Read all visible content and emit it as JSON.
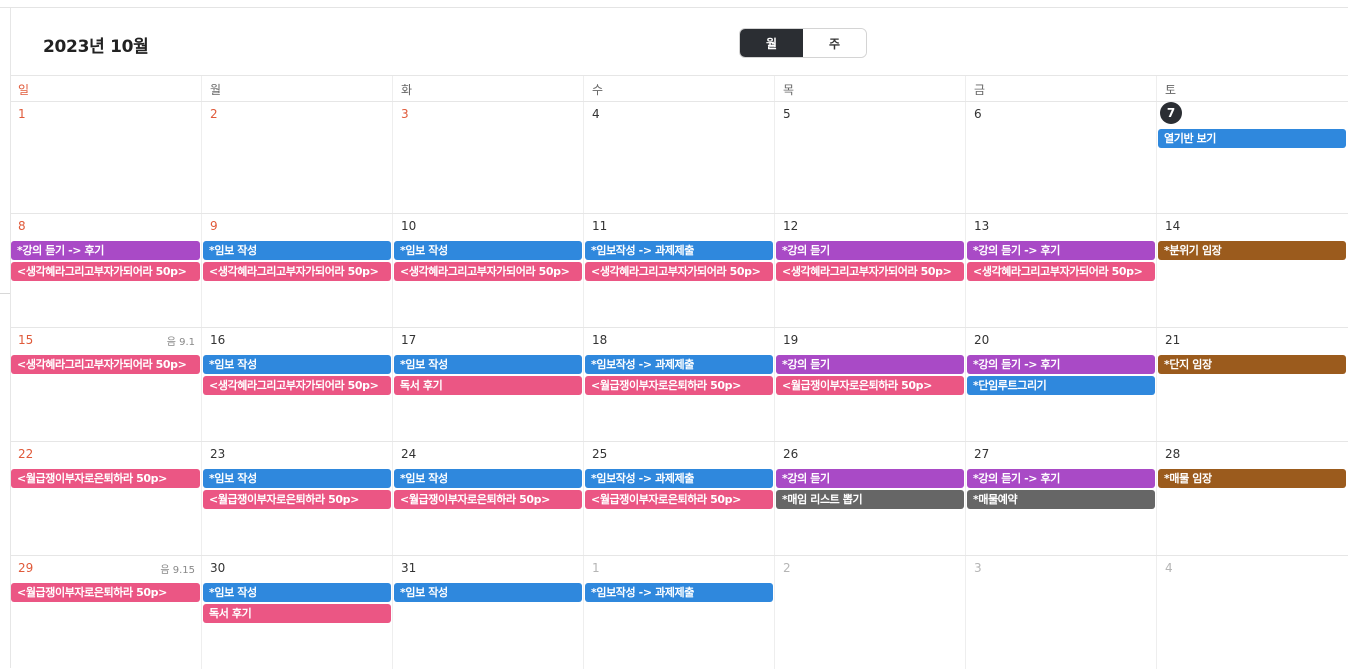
{
  "header": {
    "title": "2023년 10월"
  },
  "view_toggle": {
    "month": "월",
    "week": "주",
    "active": "month"
  },
  "colors": {
    "blue": "#2f88dd",
    "purple": "#a94ac6",
    "pink": "#eb5684",
    "brown": "#9b5b1d",
    "gray": "#666666",
    "sunday_red": "#e05a3a",
    "today_badge": "#2b2e33"
  },
  "dow": [
    "일",
    "월",
    "화",
    "수",
    "목",
    "금",
    "토"
  ],
  "weeks": [
    [
      {
        "day": "1",
        "red": true,
        "events": []
      },
      {
        "day": "2",
        "red": true,
        "events": []
      },
      {
        "day": "3",
        "red": true,
        "events": []
      },
      {
        "day": "4",
        "events": []
      },
      {
        "day": "5",
        "events": []
      },
      {
        "day": "6",
        "events": []
      },
      {
        "day": "7",
        "today": true,
        "events": [
          {
            "label": "열기반 보기",
            "color": "blue"
          }
        ]
      }
    ],
    [
      {
        "day": "8",
        "red": true,
        "events": [
          {
            "label": "*강의 듣기 -> 후기",
            "color": "purple"
          },
          {
            "label": "<생각혜라그리고부자가되어라 50p>",
            "color": "pink"
          }
        ]
      },
      {
        "day": "9",
        "red": true,
        "events": [
          {
            "label": "*임보 작성",
            "color": "blue"
          },
          {
            "label": "<생각혜라그리고부자가되어라 50p>",
            "color": "pink"
          }
        ]
      },
      {
        "day": "10",
        "events": [
          {
            "label": "*임보 작성",
            "color": "blue"
          },
          {
            "label": "<생각혜라그리고부자가되어라 50p>",
            "color": "pink"
          }
        ]
      },
      {
        "day": "11",
        "events": [
          {
            "label": "*임보작성 -> 과제제출",
            "color": "blue"
          },
          {
            "label": "<생각혜라그리고부자가되어라 50p>",
            "color": "pink"
          }
        ]
      },
      {
        "day": "12",
        "events": [
          {
            "label": "*강의 듣기",
            "color": "purple"
          },
          {
            "label": "<생각혜라그리고부자가되어라 50p>",
            "color": "pink"
          }
        ]
      },
      {
        "day": "13",
        "events": [
          {
            "label": "*강의 듣기 -> 후기",
            "color": "purple"
          },
          {
            "label": "<생각혜라그리고부자가되어라 50p>",
            "color": "pink"
          }
        ]
      },
      {
        "day": "14",
        "events": [
          {
            "label": "*분위기 임장",
            "color": "brown"
          }
        ]
      }
    ],
    [
      {
        "day": "15",
        "red": true,
        "lunar": "음 9.1",
        "events": [
          {
            "label": "<생각혜라그리고부자가되어라 50p>",
            "color": "pink"
          }
        ]
      },
      {
        "day": "16",
        "events": [
          {
            "label": "*임보 작성",
            "color": "blue"
          },
          {
            "label": "<생각혜라그리고부자가되어라 50p>",
            "color": "pink"
          }
        ]
      },
      {
        "day": "17",
        "events": [
          {
            "label": "*임보 작성",
            "color": "blue"
          },
          {
            "label": "독서 후기",
            "color": "pink"
          }
        ]
      },
      {
        "day": "18",
        "events": [
          {
            "label": "*임보작성 -> 과제제출",
            "color": "blue"
          },
          {
            "label": "<월급쟁이부자로은퇴하라 50p>",
            "color": "pink"
          }
        ]
      },
      {
        "day": "19",
        "events": [
          {
            "label": "*강의 듣기",
            "color": "purple"
          },
          {
            "label": "<월급쟁이부자로은퇴하라 50p>",
            "color": "pink"
          }
        ]
      },
      {
        "day": "20",
        "events": [
          {
            "label": "*강의 듣기 -> 후기",
            "color": "purple"
          },
          {
            "label": "*단임루트그리기",
            "color": "blue"
          }
        ]
      },
      {
        "day": "21",
        "events": [
          {
            "label": "*단지 임장",
            "color": "brown"
          }
        ]
      }
    ],
    [
      {
        "day": "22",
        "red": true,
        "events": [
          {
            "label": "<월급쟁이부자로은퇴하라 50p>",
            "color": "pink"
          }
        ]
      },
      {
        "day": "23",
        "events": [
          {
            "label": "*임보 작성",
            "color": "blue"
          },
          {
            "label": "<월급쟁이부자로은퇴하라 50p>",
            "color": "pink"
          }
        ]
      },
      {
        "day": "24",
        "events": [
          {
            "label": "*임보 작성",
            "color": "blue"
          },
          {
            "label": "<월급쟁이부자로은퇴하라 50p>",
            "color": "pink"
          }
        ]
      },
      {
        "day": "25",
        "events": [
          {
            "label": "*임보작성 -> 과제제출",
            "color": "blue"
          },
          {
            "label": "<월급쟁이부자로은퇴하라 50p>",
            "color": "pink"
          }
        ]
      },
      {
        "day": "26",
        "events": [
          {
            "label": "*강의 듣기",
            "color": "purple"
          },
          {
            "label": "*매임 리스트 뽑기",
            "color": "gray"
          }
        ]
      },
      {
        "day": "27",
        "events": [
          {
            "label": "*강의 듣기 -> 후기",
            "color": "purple"
          },
          {
            "label": "*매물예약",
            "color": "gray"
          }
        ]
      },
      {
        "day": "28",
        "events": [
          {
            "label": "*매물 임장",
            "color": "brown"
          }
        ]
      }
    ],
    [
      {
        "day": "29",
        "red": true,
        "lunar": "음 9.15",
        "events": [
          {
            "label": "<월급쟁이부자로은퇴하라 50p>",
            "color": "pink"
          }
        ]
      },
      {
        "day": "30",
        "events": [
          {
            "label": "*임보 작성",
            "color": "blue"
          },
          {
            "label": "독서 후기",
            "color": "pink"
          }
        ]
      },
      {
        "day": "31",
        "events": [
          {
            "label": "*임보 작성",
            "color": "blue"
          }
        ]
      },
      {
        "day": "1",
        "muted": true,
        "events": [
          {
            "label": "*임보작성 -> 과제제출",
            "color": "blue"
          }
        ]
      },
      {
        "day": "2",
        "muted": true,
        "events": []
      },
      {
        "day": "3",
        "muted": true,
        "events": []
      },
      {
        "day": "4",
        "muted": true,
        "events": []
      }
    ]
  ]
}
